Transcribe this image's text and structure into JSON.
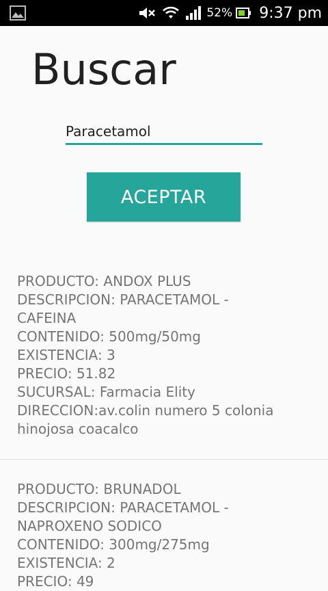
{
  "status_bar": {
    "battery_percent": "52%",
    "time": "9:37 pm",
    "icons": [
      "gallery-icon",
      "mute-icon",
      "wifi-icon",
      "signal-icon",
      "battery-icon"
    ]
  },
  "page": {
    "title": "Buscar",
    "search": {
      "value": "Paracetamol",
      "placeholder": ""
    },
    "accept_label": "ACEPTAR"
  },
  "results": [
    {
      "lines": [
        "PRODUCTO: ANDOX PLUS",
        "DESCRIPCION: PARACETAMOL -",
        "CAFEINA",
        "CONTENIDO: 500mg/50mg",
        "EXISTENCIA: 3",
        "PRECIO: 51.82",
        "SUCURSAL: Farmacia Elity",
        "DIRECCION:av.colin numero 5 colonia",
        "hinojosa coacalco"
      ]
    },
    {
      "lines": [
        "PRODUCTO: BRUNADOL",
        "DESCRIPCION: PARACETAMOL -",
        "NAPROXENO SODICO",
        "CONTENIDO: 300mg/275mg",
        "EXISTENCIA: 2",
        "PRECIO: 49"
      ]
    }
  ],
  "colors": {
    "accent": "#26a69a",
    "text_secondary": "#757575",
    "background": "#fafafa"
  }
}
